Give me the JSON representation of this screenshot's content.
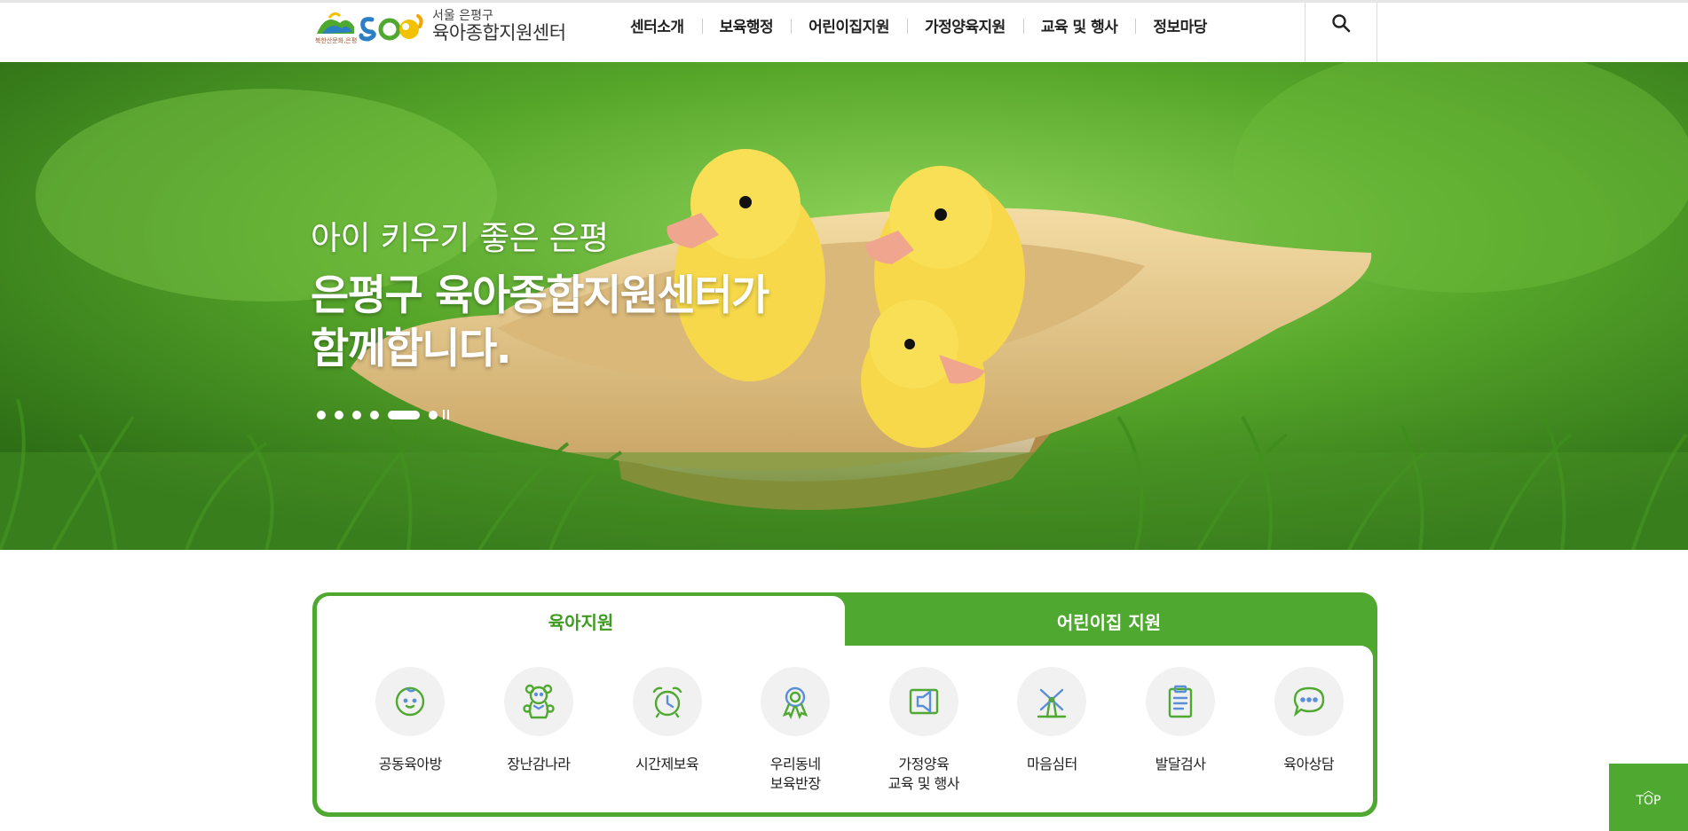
{
  "brand": {
    "logo_slogan": "북한산문화,은평",
    "subtitle": "서울 은평구",
    "title": "육아종합지원센터",
    "colors": {
      "green": "#4fa82f",
      "blue": "#2b7fc4",
      "yellow": "#f2c200"
    }
  },
  "nav": {
    "items": [
      "센터소개",
      "보육행정",
      "어린이집지원",
      "가정양육지원",
      "교육 및 행사",
      "정보마당"
    ],
    "search_icon": "search-icon"
  },
  "hero": {
    "subtitle": "아이 키우기 좋은 은평",
    "title_line1": "은평구 육아종합지원센터가",
    "title_line2": "함께합니다.",
    "slides_count": 6,
    "active_slide": 5
  },
  "tabs": [
    {
      "label": "육아지원",
      "active": true
    },
    {
      "label": "어린이집 지원",
      "active": false
    }
  ],
  "services": [
    {
      "label": "공동육아방",
      "icon": "baby-face-icon"
    },
    {
      "label": "장난감나라",
      "icon": "teddy-bear-icon"
    },
    {
      "label": "시간제보육",
      "icon": "alarm-clock-icon"
    },
    {
      "label": "우리동네\n보육반장",
      "icon": "badge-ribbon-icon"
    },
    {
      "label": "가정양육\n교육 및 행사",
      "icon": "speaker-icon"
    },
    {
      "label": "마음심터",
      "icon": "windmill-icon"
    },
    {
      "label": "발달검사",
      "icon": "clipboard-icon"
    },
    {
      "label": "육아상담",
      "icon": "chat-bubble-icon"
    }
  ],
  "top_button": {
    "label": "TOP",
    "icon": "chevron-up-icon"
  }
}
